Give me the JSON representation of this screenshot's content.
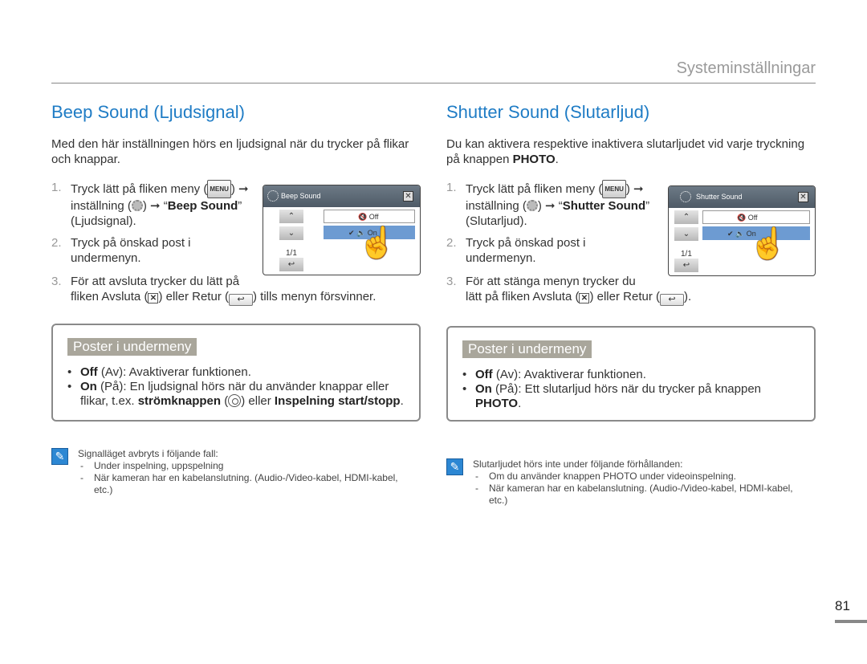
{
  "header": "Systeminställningar",
  "page_number": "81",
  "left": {
    "title": "Beep Sound (Ljudsignal)",
    "intro": "Med den här inställningen hörs en ljudsignal när du trycker på flikar och knappar.",
    "step1_a": "Tryck lätt på fliken meny (",
    "step1_b": ") ➞",
    "step1_c": "inställning (",
    "step1_d": ") ➞ “",
    "step1_item": "Beep Sound",
    "step1_e": "”",
    "step1_f": "(Ljudsignal).",
    "step2": "Tryck på önskad post i undermenyn.",
    "step3_a": "För att avsluta trycker du lätt på",
    "step3_b": "fliken Avsluta (",
    "step3_c": ") eller Retur (",
    "step3_d": ") tills menyn försvinner.",
    "screen": {
      "title": "Beep Sound",
      "off": "Off",
      "on": "On",
      "page": "1/1"
    },
    "box": {
      "tag": "Poster i undermeny",
      "b1_bold": "Off",
      "b1": " (Av): Avaktiverar funktionen.",
      "b2_bold": "On",
      "b2": " (På): En ljudsignal hörs när du använder knappar eller flikar, t.ex. ",
      "b2_bold2": "strömknappen",
      "b2_c": " (",
      "b2_d": ") eller ",
      "b2_bold3": "Inspelning start/stopp",
      "b2_e": "."
    },
    "note": {
      "head": "Signalläget avbryts i följande fall:",
      "items": [
        "Under inspelning, uppspelning",
        "När kameran har en kabelanslutning. (Audio-/Video-kabel, HDMI-kabel, etc.)"
      ]
    }
  },
  "right": {
    "title": "Shutter Sound (Slutarljud)",
    "intro_a": "Du kan aktivera respektive inaktivera slutarljudet vid varje tryckning på knappen ",
    "intro_bold": "PHOTO",
    "intro_b": ".",
    "step1_a": "Tryck lätt på fliken meny (",
    "step1_b": ") ➞",
    "step1_c": "inställning (",
    "step1_d": ") ➞ “",
    "step1_item": "Shutter Sound",
    "step1_e": "”",
    "step1_f": "(Slutarljud).",
    "step2": "Tryck på önskad post i undermenyn.",
    "step3_a": "För att stänga menyn trycker du",
    "step3_b": "lätt på fliken Avsluta (",
    "step3_c": ") eller Retur (",
    "step3_d": ").",
    "screen": {
      "title": "Shutter Sound",
      "off": "Off",
      "on": "On",
      "page": "1/1"
    },
    "box": {
      "tag": "Poster i undermeny",
      "b1_bold": "Off",
      "b1": " (Av): Avaktiverar funktionen.",
      "b2_bold": "On",
      "b2": " (På): Ett slutarljud hörs när du trycker på knappen ",
      "b2_bold2": "PHOTO",
      "b2_e": "."
    },
    "note": {
      "head": "Slutarljudet hörs inte under följande förhållanden:",
      "items": [
        "Om du använder knappen PHOTO under videoinspelning.",
        "När kameran har en kabelanslutning. (Audio-/Video-kabel, HDMI-kabel, etc.)"
      ]
    }
  },
  "icons": {
    "menu": "MENU",
    "num1": "1.",
    "num2": "2.",
    "num3": "3."
  },
  "colors": {
    "title": "#1f7cc5",
    "selected": "#6d9bd2",
    "tag": "#a9a69b"
  }
}
